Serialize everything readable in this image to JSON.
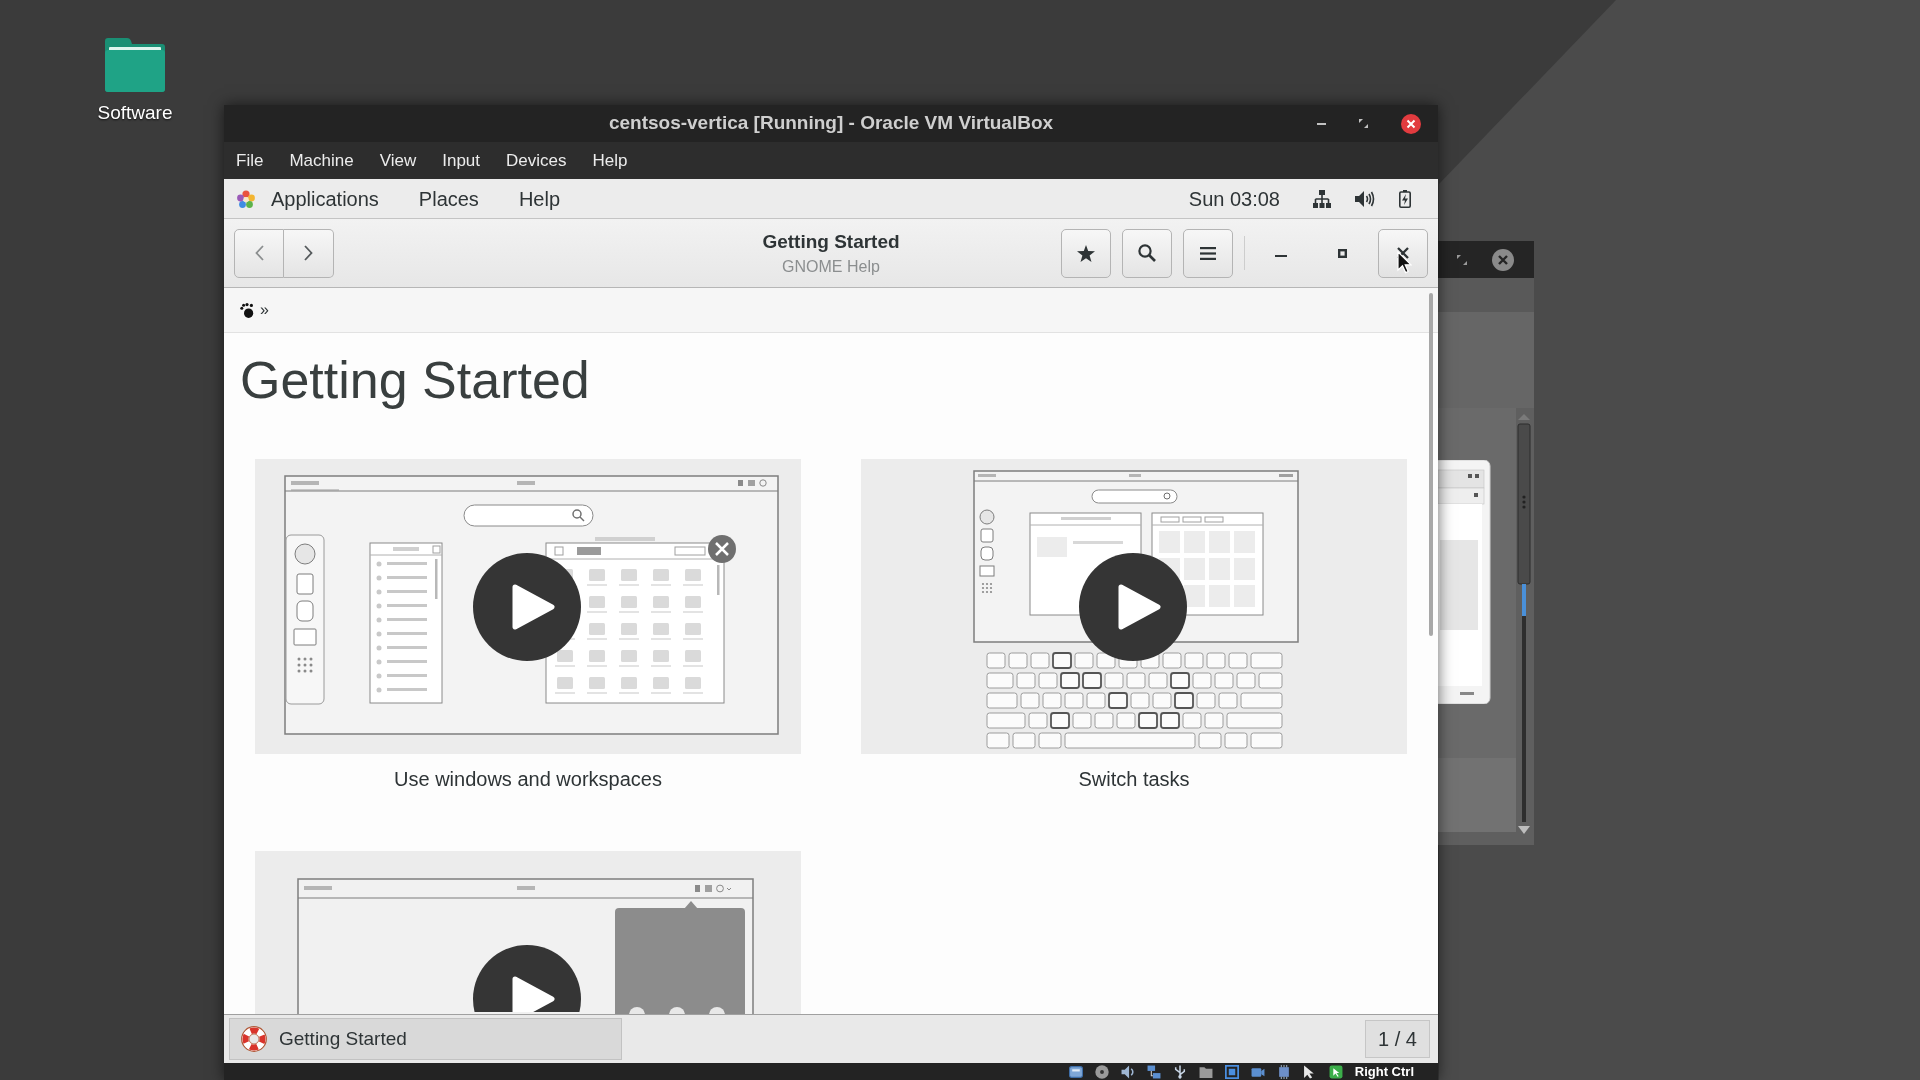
{
  "desktop": {
    "icons": [
      {
        "label": "Software"
      }
    ]
  },
  "virtualbox_window": {
    "title": "centsos-vertica [Running] - Oracle VM VirtualBox",
    "menu": [
      "File",
      "Machine",
      "View",
      "Input",
      "Devices",
      "Help"
    ],
    "status_bar": {
      "host_key": "Right Ctrl"
    }
  },
  "gnome_top_bar": {
    "menus": [
      "Applications",
      "Places",
      "Help"
    ],
    "clock": "Sun 03:08"
  },
  "help_window": {
    "title": "Getting Started",
    "subtitle": "GNOME Help",
    "close_button": {
      "hovered": true
    },
    "breadcrumb_separator": "»",
    "heading": "Getting Started",
    "videos": [
      {
        "kind": "windows",
        "caption": "Use windows and workspaces"
      },
      {
        "kind": "keyboard",
        "caption": "Switch tasks"
      },
      {
        "kind": "menu"
      }
    ]
  },
  "window_list": {
    "items": [
      {
        "label": "Getting Started",
        "selected": true
      }
    ],
    "workspace": "1 / 4"
  }
}
